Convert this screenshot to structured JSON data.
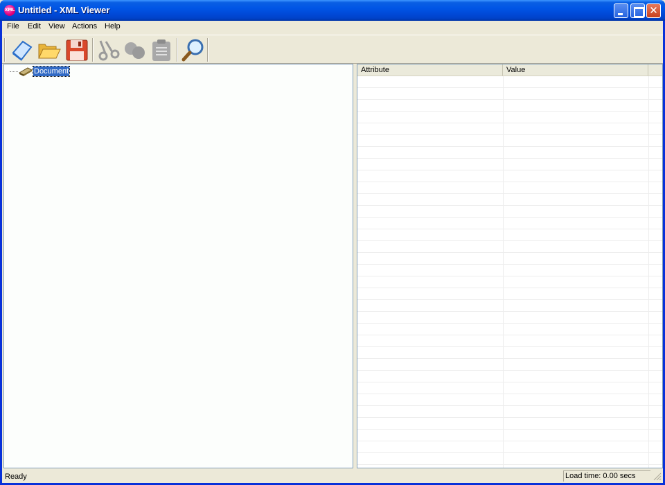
{
  "window": {
    "title": "Untitled - XML Viewer",
    "icon_text": "XML",
    "controls": [
      "minimize-icon",
      "maximize-icon",
      "close-icon"
    ]
  },
  "menu": {
    "file": "File",
    "edit": "Edit",
    "view": "View",
    "actions": "Actions",
    "help": "Help"
  },
  "toolbar": {
    "buttons": [
      {
        "icon": "new-document-icon",
        "enabled": true
      },
      {
        "icon": "open-folder-icon",
        "enabled": true
      },
      {
        "icon": "save-disk-icon",
        "enabled": true
      },
      {
        "icon": "cut-scissors-icon",
        "enabled": false
      },
      {
        "icon": "copy-icon",
        "enabled": false
      },
      {
        "icon": "paste-clipboard-icon",
        "enabled": false
      },
      {
        "icon": "find-magnifier-icon",
        "enabled": true
      }
    ]
  },
  "tree": {
    "root_label": "Document"
  },
  "attributes_table": {
    "columns": [
      "Attribute",
      "Value"
    ],
    "rows": []
  },
  "status": {
    "left": "Ready",
    "load_time": "Load time: 0.00 secs"
  },
  "colors": {
    "titlebar": "#0055E5",
    "selection": "#316AC5",
    "window_bg": "#ECE9D8"
  }
}
